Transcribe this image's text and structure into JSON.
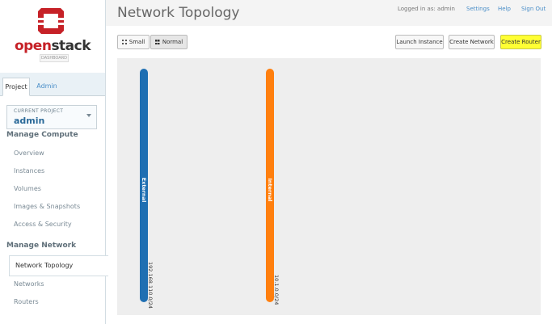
{
  "brand": {
    "logo_open": "open",
    "logo_stack": "stack",
    "logo_sub": "DASHBOARD"
  },
  "sidebar": {
    "tabs": [
      {
        "label": "Project"
      },
      {
        "label": "Admin"
      }
    ],
    "current_project_label": "CURRENT PROJECT",
    "current_project": "admin",
    "sections": [
      {
        "title": "Manage Compute",
        "items": [
          "Overview",
          "Instances",
          "Volumes",
          "Images & Snapshots",
          "Access & Security"
        ]
      },
      {
        "title": "Manage Network",
        "items": [
          "Network Topology",
          "Networks",
          "Routers"
        ]
      }
    ],
    "active_item": "Network Topology"
  },
  "header": {
    "title": "Network Topology",
    "logged_in": "Logged in as: admin",
    "links": [
      "Settings",
      "Help",
      "Sign Out"
    ]
  },
  "toolbar": {
    "small_label": "Small",
    "normal_label": "Normal",
    "launch_label": "Launch Instance",
    "create_network_label": "Create Network",
    "create_router_label": "Create Router",
    "highlight_color": "#ffff33"
  },
  "topology": {
    "networks": [
      {
        "name": "External",
        "cidr": "192.168.110.0/24",
        "color": "#1f6fb2"
      },
      {
        "name": "Internal",
        "cidr": "10.1.0.0/24",
        "color": "#ff7f0e"
      }
    ]
  }
}
